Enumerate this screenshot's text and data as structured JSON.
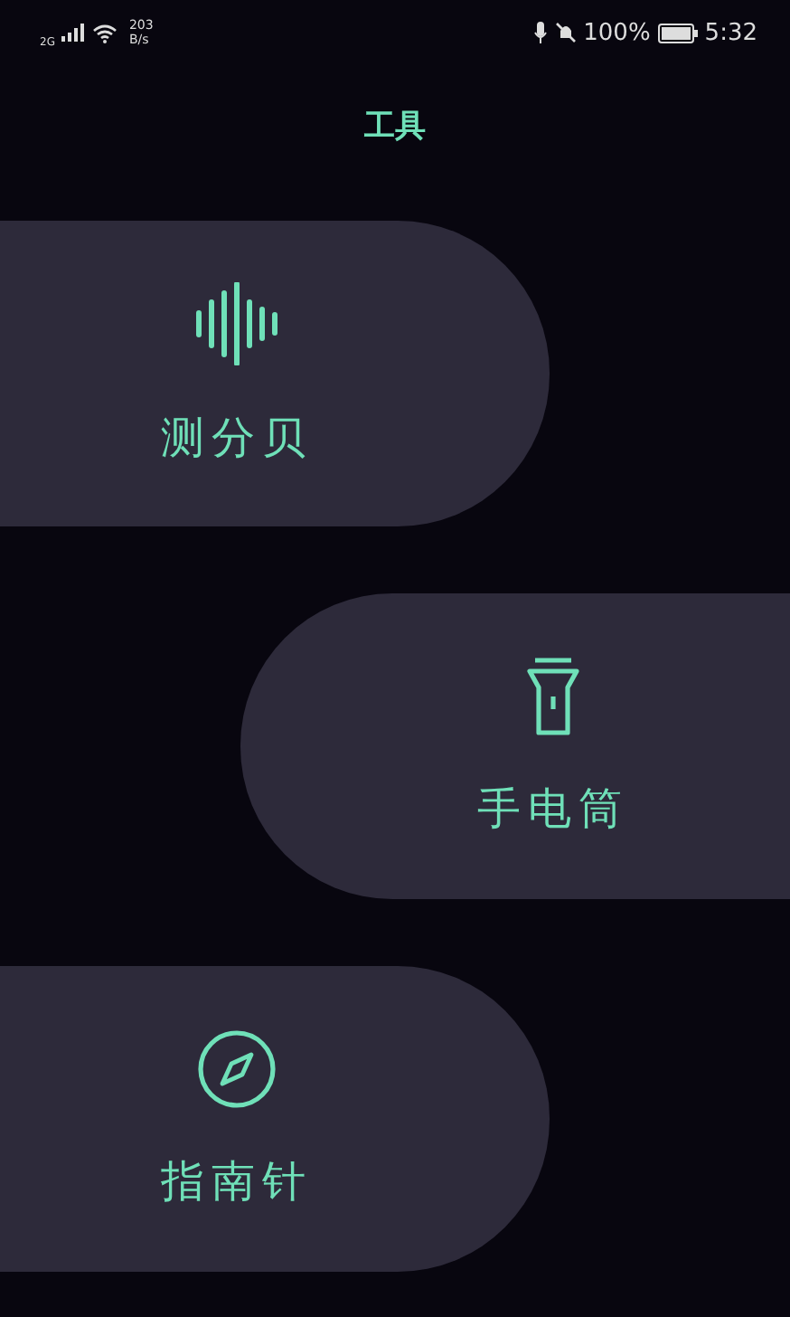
{
  "status_bar": {
    "network": "2G",
    "speed_value": "203",
    "speed_unit": "B/s",
    "battery": "100%",
    "time": "5:32"
  },
  "title": "工具",
  "tools": [
    {
      "kind": "decibel",
      "label": "测分贝"
    },
    {
      "kind": "flashlight",
      "label": "手电筒"
    },
    {
      "kind": "compass",
      "label": "指南针"
    }
  ]
}
